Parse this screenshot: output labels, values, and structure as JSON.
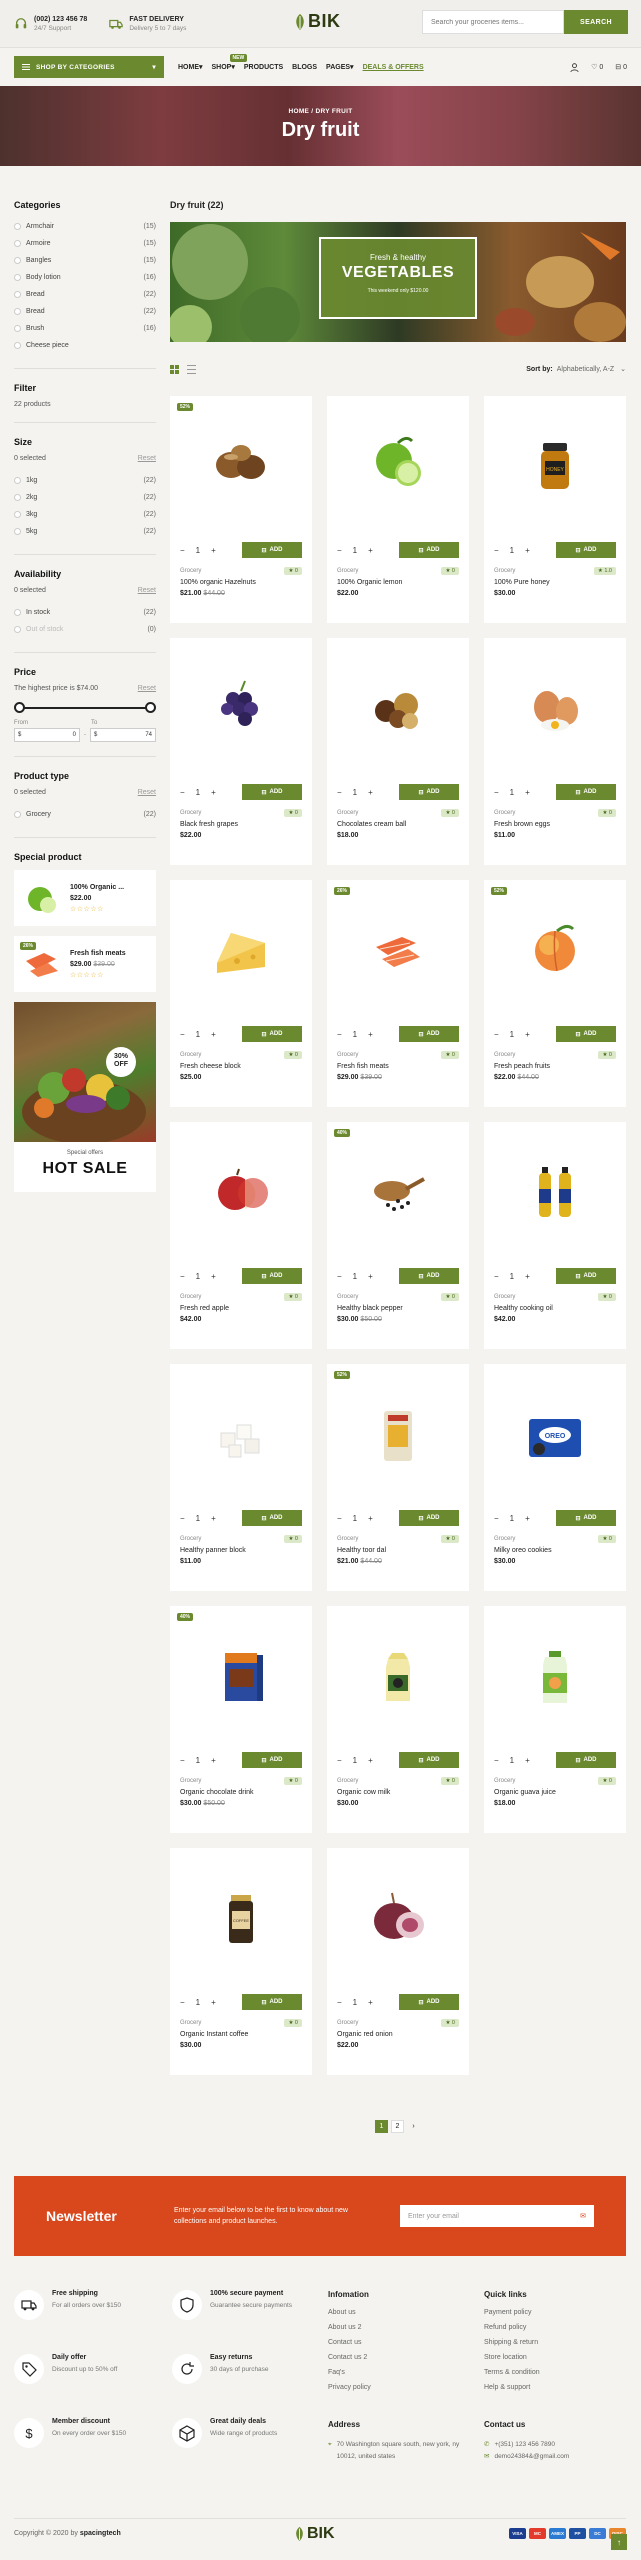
{
  "topbar": {
    "phone": "(002) 123 456 78",
    "support": "24/7 Support",
    "delivery_title": "FAST DELIVERY",
    "delivery_sub": "Delivery 5 to 7 days",
    "logo_text": "BIK",
    "search_placeholder": "Search your groceries items...",
    "search_button": "SEARCH"
  },
  "nav": {
    "categories_button": "SHOP BY CATEGORIES",
    "items": [
      {
        "label": "HOME",
        "chev": "▾"
      },
      {
        "label": "SHOP",
        "chev": "▾",
        "tag": "NEW"
      },
      {
        "label": "PRODUCTS",
        "chev": ""
      },
      {
        "label": "BLOGS",
        "chev": ""
      },
      {
        "label": "PAGES",
        "chev": "▾"
      },
      {
        "label": "DEALS & OFFERS",
        "chev": ""
      }
    ],
    "wishlist_count": "0",
    "cart_count": "0"
  },
  "hero": {
    "breadcrumb_home": "HOME",
    "breadcrumb_sep": "/",
    "breadcrumb_current": "DRY FRUIT",
    "title": "Dry fruit"
  },
  "sidebar": {
    "categories_title": "Categories",
    "categories": [
      {
        "name": "Armchair",
        "count": "(15)"
      },
      {
        "name": "Armoire",
        "count": "(15)"
      },
      {
        "name": "Bangles",
        "count": "(15)"
      },
      {
        "name": "Body lotion",
        "count": "(16)"
      },
      {
        "name": "Bread",
        "count": "(22)"
      },
      {
        "name": "Bread",
        "count": "(22)"
      },
      {
        "name": "Brush",
        "count": "(16)"
      },
      {
        "name": "Cheese piece",
        "count": ""
      }
    ],
    "filter_title": "Filter",
    "filter_count": "22 products",
    "size_title": "Size",
    "size_selected": "0 selected",
    "reset": "Reset",
    "sizes": [
      {
        "name": "1kg",
        "count": "(22)"
      },
      {
        "name": "2kg",
        "count": "(22)"
      },
      {
        "name": "3kg",
        "count": "(22)"
      },
      {
        "name": "5kg",
        "count": "(22)"
      }
    ],
    "availability_title": "Availability",
    "availability_selected": "0 selected",
    "availability": [
      {
        "name": "In stock",
        "count": "(22)"
      },
      {
        "name": "Out of stock",
        "count": "(0)"
      }
    ],
    "price_title": "Price",
    "price_highest": "The highest price is $74.00",
    "price_from_label": "From",
    "price_to_label": "To",
    "price_from_currency": "$",
    "price_from_value": "0",
    "price_to_currency": "$",
    "price_to_value": "74",
    "price_dash": "-",
    "ptype_title": "Product type",
    "ptype_selected": "0 selected",
    "ptypes": [
      {
        "name": "Grocery",
        "count": "(22)"
      }
    ],
    "special_title": "Special product",
    "special": [
      {
        "name": "100% Organic ...",
        "price": "$22.00",
        "old": "",
        "stars": "☆☆☆☆☆",
        "badge": ""
      },
      {
        "name": "Fresh fish meats",
        "price": "$29.00",
        "old": "$39.00",
        "stars": "☆☆☆☆☆",
        "badge": "26%"
      }
    ],
    "promo_off": "30%",
    "promo_off2": "OFF",
    "promo_small": "Special offers",
    "promo_big": "HOT SALE"
  },
  "main": {
    "title": "Dry fruit (22)",
    "banner_l1": "Fresh & healthy",
    "banner_l2": "VEGETABLES",
    "banner_l3": "This weekend only $120.00",
    "sort_label": "Sort by:",
    "sort_value": "Alphabetically, A-Z",
    "qty_minus": "−",
    "qty_value": "1",
    "qty_plus": "+",
    "add_label": "ADD",
    "products": [
      {
        "name": "100% organic Hazelnuts",
        "cat": "Grocery",
        "price": "$21.00",
        "old": "$44.00",
        "rating": "★ 0",
        "badge": "52%",
        "img": "hazelnut"
      },
      {
        "name": "100% Organic lemon",
        "cat": "Grocery",
        "price": "$22.00",
        "old": "",
        "rating": "★ 0",
        "badge": "",
        "img": "lime"
      },
      {
        "name": "100% Pure honey",
        "cat": "Grocery",
        "price": "$30.00",
        "old": "",
        "rating": "★ 1.0",
        "badge": "",
        "img": "honey"
      },
      {
        "name": "Black fresh grapes",
        "cat": "Grocery",
        "price": "$22.00",
        "old": "",
        "rating": "★ 0",
        "badge": "",
        "img": "grapes"
      },
      {
        "name": "Chocolates cream ball",
        "cat": "Grocery",
        "price": "$18.00",
        "old": "",
        "rating": "★ 0",
        "badge": "",
        "img": "choco"
      },
      {
        "name": "Fresh brown eggs",
        "cat": "Grocery",
        "price": "$11.00",
        "old": "",
        "rating": "★ 0",
        "badge": "",
        "img": "eggs"
      },
      {
        "name": "Fresh cheese block",
        "cat": "Grocery",
        "price": "$25.00",
        "old": "",
        "rating": "★ 0",
        "badge": "",
        "img": "cheese"
      },
      {
        "name": "Fresh fish meats",
        "cat": "Grocery",
        "price": "$29.00",
        "old": "$39.00",
        "rating": "★ 0",
        "badge": "26%",
        "img": "fish"
      },
      {
        "name": "Fresh peach fruits",
        "cat": "Grocery",
        "price": "$22.00",
        "old": "$44.00",
        "rating": "★ 0",
        "badge": "52%",
        "img": "peach"
      },
      {
        "name": "Fresh red apple",
        "cat": "Grocery",
        "price": "$42.00",
        "old": "",
        "rating": "★ 0",
        "badge": "",
        "img": "apple"
      },
      {
        "name": "Healthy black pepper",
        "cat": "Grocery",
        "price": "$30.00",
        "old": "$50.00",
        "rating": "★ 0",
        "badge": "40%",
        "img": "pepper"
      },
      {
        "name": "Healthy cooking oil",
        "cat": "Grocery",
        "price": "$42.00",
        "old": "",
        "rating": "★ 0",
        "badge": "",
        "img": "oil"
      },
      {
        "name": "Healthy panner block",
        "cat": "Grocery",
        "price": "$11.00",
        "old": "",
        "rating": "★ 0",
        "badge": "",
        "img": "paneer"
      },
      {
        "name": "Healthy toor dal",
        "cat": "Grocery",
        "price": "$21.00",
        "old": "$44.00",
        "rating": "★ 0",
        "badge": "52%",
        "img": "dal"
      },
      {
        "name": "Milky oreo cookies",
        "cat": "Grocery",
        "price": "$30.00",
        "old": "",
        "rating": "★ 0",
        "badge": "",
        "img": "oreo"
      },
      {
        "name": "Organic chocolate drink",
        "cat": "Grocery",
        "price": "$30.00",
        "old": "$50.00",
        "rating": "★ 0",
        "badge": "40%",
        "img": "chocodrink"
      },
      {
        "name": "Organic cow milk",
        "cat": "Grocery",
        "price": "$30.00",
        "old": "",
        "rating": "★ 0",
        "badge": "",
        "img": "milk"
      },
      {
        "name": "Organic guava juice",
        "cat": "Grocery",
        "price": "$18.00",
        "old": "",
        "rating": "★ 0",
        "badge": "",
        "img": "juice"
      },
      {
        "name": "Organic Instant coffee",
        "cat": "Grocery",
        "price": "$30.00",
        "old": "",
        "rating": "★ 0",
        "badge": "",
        "img": "coffee"
      },
      {
        "name": "Organic red onion",
        "cat": "Grocery",
        "price": "$22.00",
        "old": "",
        "rating": "★ 0",
        "badge": "",
        "img": "onion"
      }
    ]
  },
  "pagination": {
    "page1": "1",
    "page2": "2",
    "next": "›"
  },
  "newsletter": {
    "title": "Newsletter",
    "desc": "Enter your email below to be the first to know about new collections and product launches.",
    "placeholder": "Enter your email"
  },
  "footer": {
    "features": [
      {
        "title": "Free shipping",
        "desc": "For all orders over $150",
        "icon": "truck"
      },
      {
        "title": "100% secure payment",
        "desc": "Guarantee secure payments",
        "icon": "shield"
      },
      {
        "title": "Daily offer",
        "desc": "Discount up to 50% off",
        "icon": "tag"
      },
      {
        "title": "Easy returns",
        "desc": "30 days of purchase",
        "icon": "return"
      },
      {
        "title": "Member discount",
        "desc": "On every order over $150",
        "icon": "dollar"
      },
      {
        "title": "Great daily deals",
        "desc": "Wide range of products",
        "icon": "box"
      }
    ],
    "info_title": "Infomation",
    "info_links": [
      "About us",
      "About us 2",
      "Contact us",
      "Contact us 2",
      "Faq's",
      "Privacy policy"
    ],
    "quick_title": "Quick links",
    "quick_links": [
      "Payment policy",
      "Refund policy",
      "Shipping & return",
      "Store location",
      "Terms & condition",
      "Help & support"
    ],
    "address_title": "Address",
    "address": "70 Washington square south, new york, ny 10012, united states",
    "contact_title": "Contact us",
    "phone": "+(351) 123 456 7890",
    "email": "demo24384&@gmail.com",
    "copyright_pre": "Copyright © 2020 by",
    "copyright_brand": "spacingtech",
    "payments": [
      {
        "name": "VISA",
        "color": "#1a3d8f"
      },
      {
        "name": "MC",
        "color": "#e33b2b"
      },
      {
        "name": "AMEX",
        "color": "#2a7ad1"
      },
      {
        "name": "PP",
        "color": "#1e4fa0"
      },
      {
        "name": "DC",
        "color": "#3a7bd5"
      },
      {
        "name": "DISC",
        "color": "#e8862b"
      }
    ]
  },
  "colors": {
    "accent": "#6b8a2f",
    "newsletter": "#d9471c",
    "rating_bg": "#dce9c8"
  }
}
